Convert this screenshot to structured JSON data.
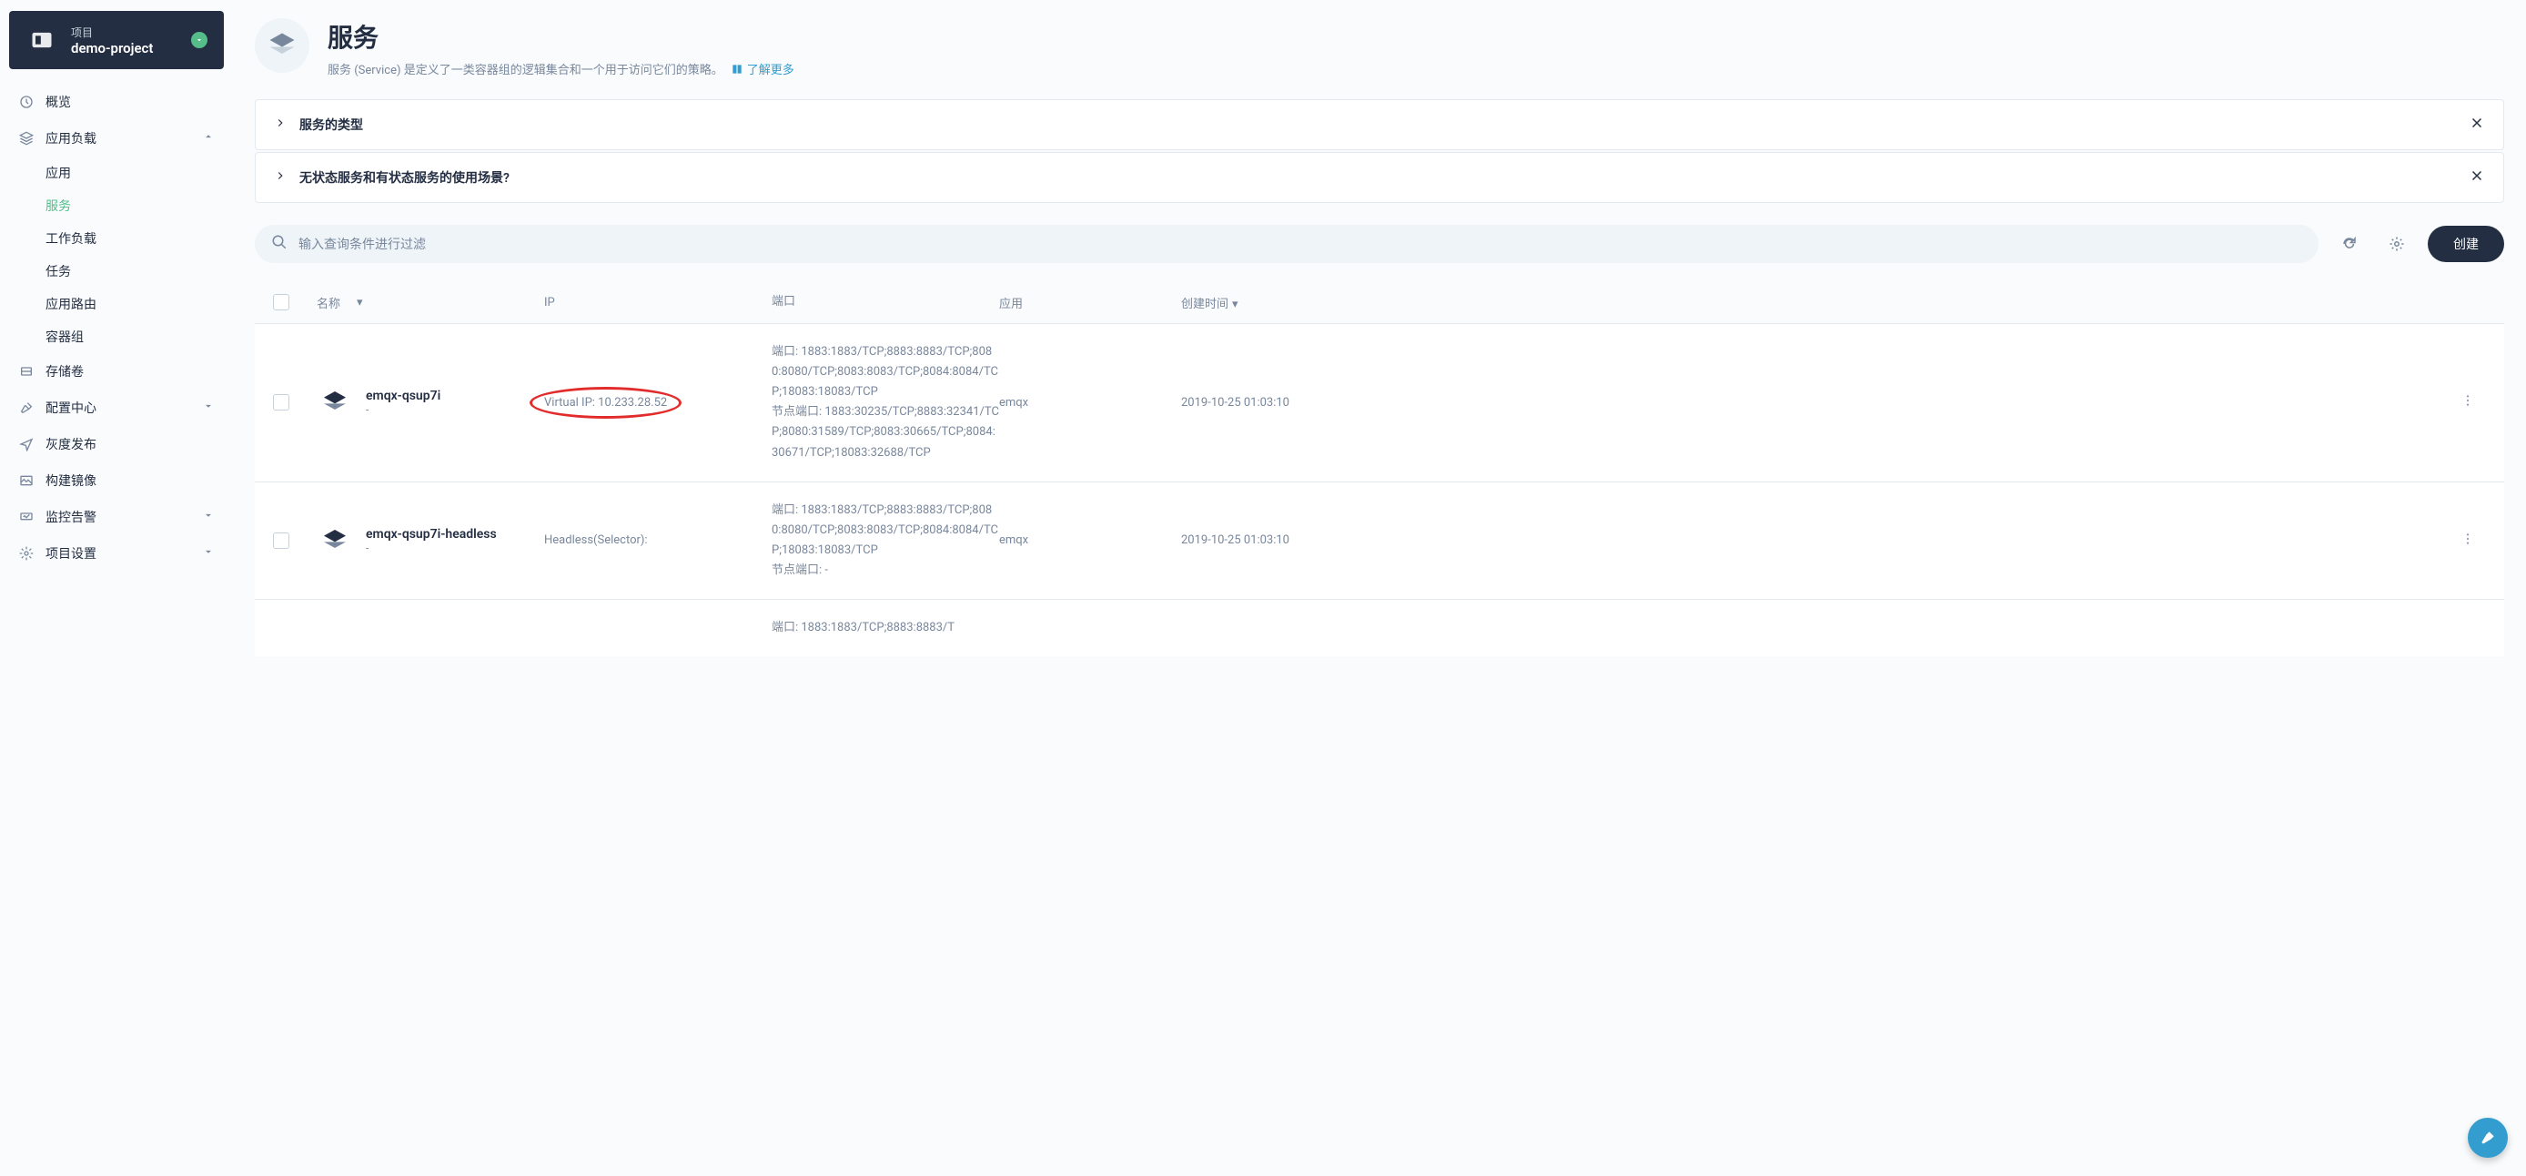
{
  "project": {
    "label": "项目",
    "name": "demo-project"
  },
  "sidebar": {
    "items": [
      {
        "label": "概览",
        "expandable": false
      },
      {
        "label": "应用负载",
        "expandable": true,
        "expanded": true,
        "children": [
          {
            "label": "应用"
          },
          {
            "label": "服务",
            "active": true
          },
          {
            "label": "工作负载"
          },
          {
            "label": "任务"
          },
          {
            "label": "应用路由"
          },
          {
            "label": "容器组"
          }
        ]
      },
      {
        "label": "存储卷",
        "expandable": false
      },
      {
        "label": "配置中心",
        "expandable": true,
        "expanded": false
      },
      {
        "label": "灰度发布",
        "expandable": false
      },
      {
        "label": "构建镜像",
        "expandable": false
      },
      {
        "label": "监控告警",
        "expandable": true,
        "expanded": false
      },
      {
        "label": "项目设置",
        "expandable": true,
        "expanded": false
      }
    ]
  },
  "header": {
    "title": "服务",
    "description": "服务 (Service) 是定义了一类容器组的逻辑集合和一个用于访问它们的策略。",
    "learn_more": "了解更多"
  },
  "panels": [
    {
      "title": "服务的类型"
    },
    {
      "title": "无状态服务和有状态服务的使用场景?"
    }
  ],
  "toolbar": {
    "search_placeholder": "输入查询条件进行过滤",
    "create_label": "创建"
  },
  "table": {
    "columns": {
      "name": "名称",
      "ip": "IP",
      "port": "端口",
      "app": "应用",
      "time": "创建时间"
    },
    "rows": [
      {
        "name": "emqx-qsup7i",
        "sub": "-",
        "ip_label": "Virtual IP: 10.233.28.52",
        "highlighted": true,
        "port_l1": "端口: 1883:1883/TCP;8883:8883/TCP;8080:8080/TCP;8083:8083/TCP;8084:8084/TCP;18083:18083/TCP",
        "port_l2": "节点端口: 1883:30235/TCP;8883:32341/TCP;8080:31589/TCP;8083:30665/TCP;8084:30671/TCP;18083:32688/TCP",
        "app": "emqx",
        "time": "2019-10-25 01:03:10"
      },
      {
        "name": "emqx-qsup7i-headless",
        "sub": "-",
        "ip_label": "Headless(Selector):",
        "highlighted": false,
        "port_l1": "端口: 1883:1883/TCP;8883:8883/TCP;8080:8080/TCP;8083:8083/TCP;8084:8084/TCP;18083:18083/TCP",
        "port_l2": "节点端口: -",
        "app": "emqx",
        "time": "2019-10-25 01:03:10"
      },
      {
        "name": "",
        "sub": "",
        "ip_label": "",
        "highlighted": false,
        "port_l1": "端口: 1883:1883/TCP;8883:8883/T",
        "port_l2": "",
        "app": "",
        "time": ""
      }
    ]
  }
}
